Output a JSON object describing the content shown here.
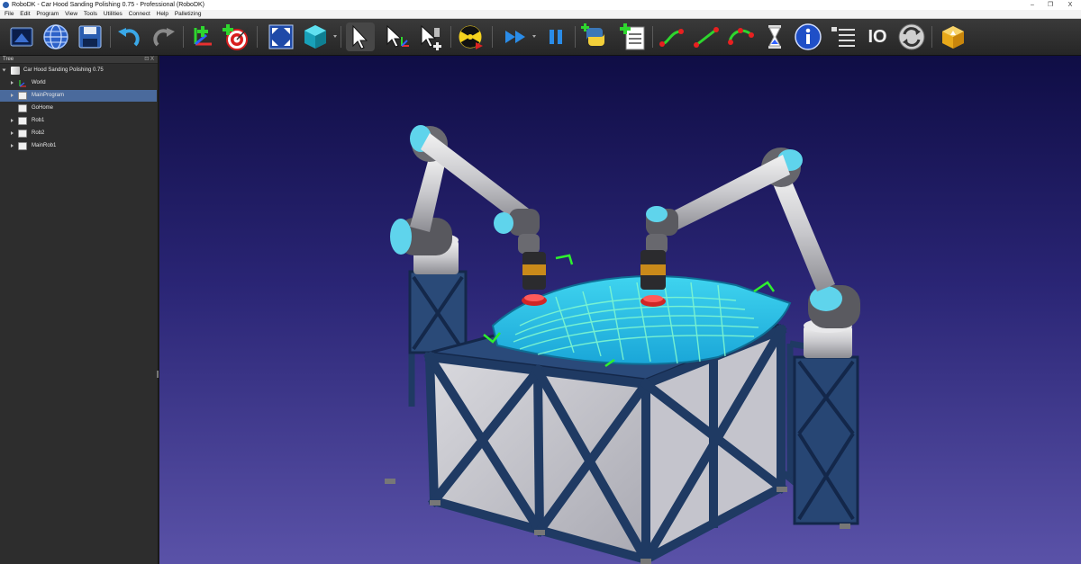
{
  "window": {
    "title": "RoboDK - Car Hood Sanding Polishing 0.75 - Professional (RoboDK)",
    "controls": {
      "minimize": "–",
      "restore": "❐",
      "close": "X"
    }
  },
  "menu": {
    "items": [
      "File",
      "Edit",
      "Program",
      "View",
      "Tools",
      "Utilities",
      "Connect",
      "Help",
      "Palletizing"
    ]
  },
  "toolbar": {
    "io_label": "IO",
    "icons": [
      "open-station-icon",
      "online-library-icon",
      "save-icon",
      "undo-icon",
      "redo-icon",
      "add-reference-frame-icon",
      "add-target-icon",
      "fit-all-icon",
      "iso-view-icon",
      "select-icon",
      "move-reference-icon",
      "move-tool-icon",
      "collision-check-icon",
      "fast-simulation-icon",
      "pause-icon",
      "python-program-icon",
      "add-program-icon",
      "move-joint-icon",
      "move-linear-icon",
      "move-circular-icon",
      "pause-instruction-icon",
      "message-icon",
      "program-instruction-icon",
      "io-icon",
      "sync-icon",
      "export-package-icon"
    ]
  },
  "tree": {
    "header": "Tree",
    "float_label": "⊡ X",
    "station": "Car Hood Sanding Polishing 0.75",
    "items": [
      {
        "label": "World",
        "icon": "frame"
      },
      {
        "label": "MainProgram",
        "icon": "program",
        "selected": true
      },
      {
        "label": "GoHome",
        "icon": "program"
      },
      {
        "label": "Rob1",
        "icon": "program"
      },
      {
        "label": "Rob2",
        "icon": "program"
      },
      {
        "label": "MainRob1",
        "icon": "program"
      }
    ]
  },
  "colors": {
    "viewport_top": "#0f0d45",
    "viewport_bottom": "#5a52a8",
    "selection": "#4a6a9c",
    "hood_surface": "#2fc6e8",
    "robot_joint_cap": "#5fd4ec",
    "frame_blue": "#1f3a63"
  }
}
